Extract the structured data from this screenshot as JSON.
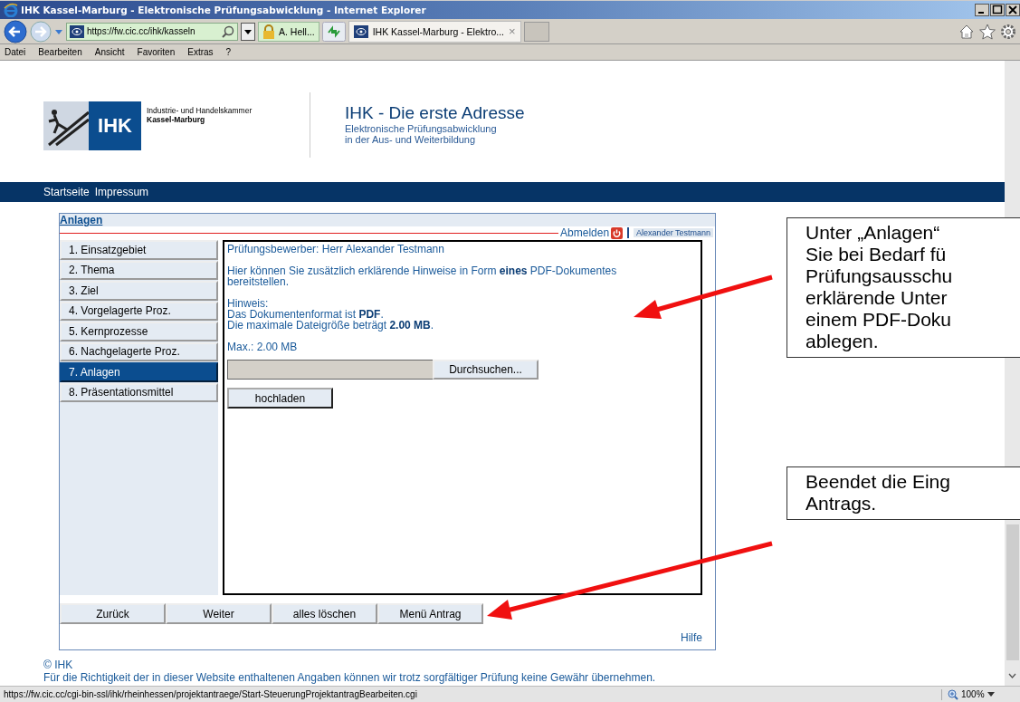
{
  "window": {
    "title": "IHK Kassel-Marburg - Elektronische Prüfungsabwicklung - Internet Explorer"
  },
  "address_bar": {
    "url": "https://fw.cic.cc/ihk/kasseln",
    "security": "A. Hell...",
    "tab": {
      "title": "IHK Kassel-Marburg - Elektro...",
      "close": "×",
      "selected": true
    }
  },
  "menu": [
    "Datei",
    "Bearbeiten",
    "Ansicht",
    "Favoriten",
    "Extras",
    "?"
  ],
  "header": {
    "org_line1": "Industrie- und Handelskammer",
    "org_line2": "Kassel-Marburg",
    "logo_text": "IHK",
    "title": "IHK - Die erste Adresse",
    "subtitle": [
      "Elektronische Prüfungsabwicklung",
      "in der Aus- und Weiterbildung"
    ]
  },
  "nav": [
    "Startseite",
    "Impressum"
  ],
  "panel": {
    "title": "Anlagen",
    "logout": "Abmelden",
    "user": "Alexander Testmann",
    "steps": [
      {
        "label": "1. Einsatzgebiet",
        "selected": false
      },
      {
        "label": "2. Thema",
        "selected": false
      },
      {
        "label": "3. Ziel",
        "selected": false
      },
      {
        "label": "4. Vorgelagerte Proz.",
        "selected": false
      },
      {
        "label": "5. Kernprozesse",
        "selected": false
      },
      {
        "label": "6. Nachgelagerte Proz.",
        "selected": false
      },
      {
        "label": "7. Anlagen",
        "selected": true
      },
      {
        "label": "8. Präsentationsmittel",
        "selected": false
      }
    ],
    "applicant": "Prüfungsbewerber: Herr Alexander Testmann",
    "intro": "Hier können Sie zusätzlich erklärende Hinweise in Form **eines** PDF-Dokumentes bereitstellen.",
    "hint_title": "Hinweis:",
    "hints": [
      "Das Dokumentenformat ist **PDF**.",
      "Die maximale Dateigröße beträgt **2.00 MB**."
    ],
    "max": "Max.: 2.00 MB",
    "browse": "Durchsuchen...",
    "upload": "hochladen",
    "buttons": [
      "Zurück",
      "Weiter",
      "alles löschen",
      "Menü Antrag"
    ],
    "help": "Hilfe"
  },
  "footer": {
    "copyright": "© IHK",
    "disclaimer": "Für die Richtigkeit der in dieser Website enthaltenen Angaben können wir trotz sorgfältiger Prüfung keine Gewähr übernehmen."
  },
  "status_bar": {
    "url": "https://fw.cic.cc/cgi-bin-ssl/ihk/rheinhessen/projektantraege/Start-SteuerungProjektantragBearbeiten.cgi",
    "zoom": "100%"
  },
  "callouts": [
    {
      "lines": [
        "Unter „Anlagen“",
        "Sie bei Bedarf fü",
        "Prüfungsausschu",
        "erklärende Unter",
        "einem PDF-Doku",
        "ablegen."
      ]
    },
    {
      "lines": [
        "Beendet die Eing",
        "Antrags."
      ]
    }
  ]
}
